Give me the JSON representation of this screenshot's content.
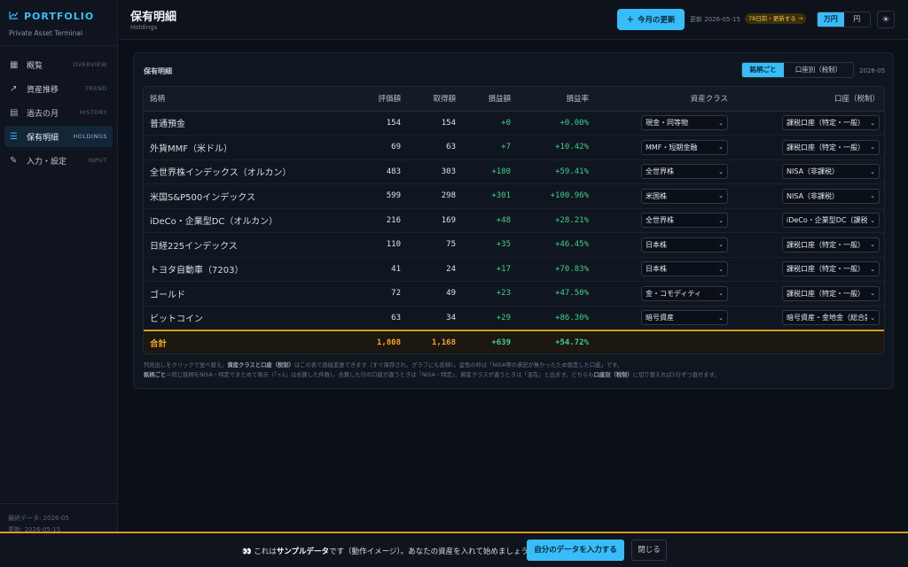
{
  "brand": {
    "name": "PORTFOLIO",
    "subtitle": "Private Asset Terminal"
  },
  "nav": [
    {
      "label": "概覧",
      "sub": "OVERVIEW",
      "icon": "grid-icon",
      "glyph": "▦",
      "active": false
    },
    {
      "label": "資産推移",
      "sub": "TREND",
      "icon": "trend-icon",
      "glyph": "↗",
      "active": false
    },
    {
      "label": "過去の月",
      "sub": "HISTORY",
      "icon": "calendar-icon",
      "glyph": "▤",
      "active": false
    },
    {
      "label": "保有明細",
      "sub": "HOLDINGS",
      "icon": "list-icon",
      "glyph": "☰",
      "active": true
    },
    {
      "label": "入力・設定",
      "sub": "INPUT",
      "icon": "pencil-icon",
      "glyph": "✎",
      "active": false
    }
  ],
  "sidebar_footer": {
    "latest": "最終データ: 2026-05",
    "updated": "更新: 2026-05-15"
  },
  "header": {
    "title": "保有明細",
    "subtitle": "Holdings",
    "update_button": "今月の更新",
    "updated": "更新 2026-05-15",
    "stale_badge": "78日前・更新する →",
    "unit_options": [
      "万円",
      "円"
    ],
    "unit_selected": "万円"
  },
  "card": {
    "title": "保有明細",
    "view_options": [
      "銘柄ごと",
      "口座別（税制）"
    ],
    "view_selected": "銘柄ごと",
    "period": "2026-05",
    "columns": [
      "銘柄",
      "評価額",
      "取得額",
      "損益額",
      "損益率",
      "資産クラス",
      "口座（税制）"
    ],
    "rows": [
      {
        "name": "普通預金",
        "value": "154",
        "cost": "154",
        "pl": "+0",
        "rate": "+0.00%",
        "class": "現金・同等物",
        "account": "課税口座（特定・一般）"
      },
      {
        "name": "外貨MMF（米ドル）",
        "value": "69",
        "cost": "63",
        "pl": "+7",
        "rate": "+10.42%",
        "class": "MMF・短期金融",
        "account": "課税口座（特定・一般）"
      },
      {
        "name": "全世界株インデックス（オルカン）",
        "value": "483",
        "cost": "303",
        "pl": "+180",
        "rate": "+59.41%",
        "class": "全世界株",
        "account": "NISA（非課税）"
      },
      {
        "name": "米国S&P500インデックス",
        "value": "599",
        "cost": "298",
        "pl": "+301",
        "rate": "+100.96%",
        "class": "米国株",
        "account": "NISA（非課税）"
      },
      {
        "name": "iDeCo・企業型DC（オルカン）",
        "value": "216",
        "cost": "169",
        "pl": "+48",
        "rate": "+28.21%",
        "class": "全世界株",
        "account": "iDeCo・企業型DC（課税繰延）"
      },
      {
        "name": "日経225インデックス",
        "value": "110",
        "cost": "75",
        "pl": "+35",
        "rate": "+46.45%",
        "class": "日本株",
        "account": "課税口座（特定・一般）"
      },
      {
        "name": "トヨタ自動車（7203）",
        "value": "41",
        "cost": "24",
        "pl": "+17",
        "rate": "+70.83%",
        "class": "日本株",
        "account": "課税口座（特定・一般）"
      },
      {
        "name": "ゴールド",
        "value": "72",
        "cost": "49",
        "pl": "+23",
        "rate": "+47.50%",
        "class": "金・コモディティ",
        "account": "課税口座（特定・一般）"
      },
      {
        "name": "ビットコイン",
        "value": "63",
        "cost": "34",
        "pl": "+29",
        "rate": "+86.30%",
        "class": "暗号資産",
        "account": "暗号資産・金地金（総合課税）"
      }
    ],
    "total": {
      "label": "合計",
      "value": "1,808",
      "cost": "1,168",
      "pl": "+639",
      "rate": "+54.72%"
    },
    "note_line1_a": "列見出しをクリックで並べ替え。",
    "note_line1_b": "資産クラスと口座（税制）",
    "note_line1_c": "はこの表で直接変更できます（すぐ保存され、グラフにも反映）。金色の枠は「NISA等の表記が無かったため仮定した口座」です。",
    "note_line2_a": "銘柄ごと",
    "note_line2_b": "＝同じ銘柄をNISA・特定でまとめて表示（「+2」は合算した件数）。合算した行の口座が違うときは「NISA・特定」、資産クラスが違うときは「混在」と出ます。どちらも",
    "note_line2_c": "口座別（税制）",
    "note_line2_d": "に切り替えれば1行ずつ直せます。"
  },
  "banner": {
    "icon_glyph": "👀",
    "text_a": "これは",
    "text_b": "サンプルデータ",
    "text_c": "です（動作イメージ）。あなたの資産を入れて始めましょう。",
    "primary": "自分のデータを入力する",
    "close": "閉じる"
  },
  "colors": {
    "accent": "#38bdf8",
    "positive": "#3ecf8e",
    "total": "#f5a524",
    "warning": "#d99a1f"
  }
}
